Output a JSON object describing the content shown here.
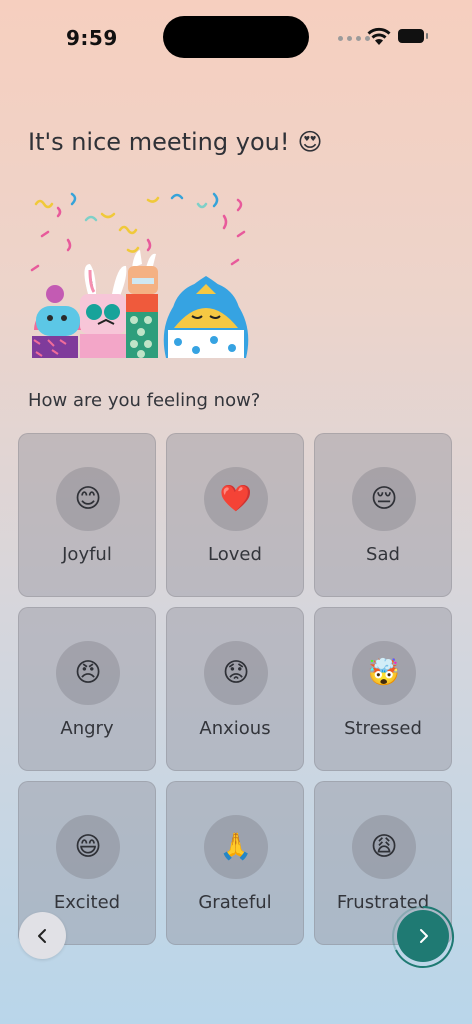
{
  "status_bar": {
    "time": "9:59"
  },
  "headline": {
    "text": "It's nice meeting you!",
    "emoji": "😍"
  },
  "question": "How are you feeling now?",
  "moods": [
    {
      "label": "Joyful",
      "emoji": "😊",
      "icon": "smiling-face-icon"
    },
    {
      "label": "Loved",
      "emoji": "❤️",
      "icon": "heart-icon"
    },
    {
      "label": "Sad",
      "emoji": "😔",
      "icon": "pensive-face-icon"
    },
    {
      "label": "Angry",
      "emoji": "😠",
      "icon": "angry-face-icon"
    },
    {
      "label": "Anxious",
      "emoji": "😟",
      "icon": "worried-face-icon"
    },
    {
      "label": "Stressed",
      "emoji": "🤯",
      "icon": "exploding-head-icon"
    },
    {
      "label": "Excited",
      "emoji": "😄",
      "icon": "grinning-face-icon"
    },
    {
      "label": "Grateful",
      "emoji": "🙏",
      "icon": "folded-hands-icon"
    },
    {
      "label": "Frustrated",
      "emoji": "😩",
      "icon": "weary-face-icon"
    }
  ],
  "colors": {
    "accent": "#1f7a73",
    "card_bg": "#a9a9b2"
  },
  "nav": {
    "back_icon": "chevron-left-icon",
    "next_icon": "chevron-right-icon"
  }
}
